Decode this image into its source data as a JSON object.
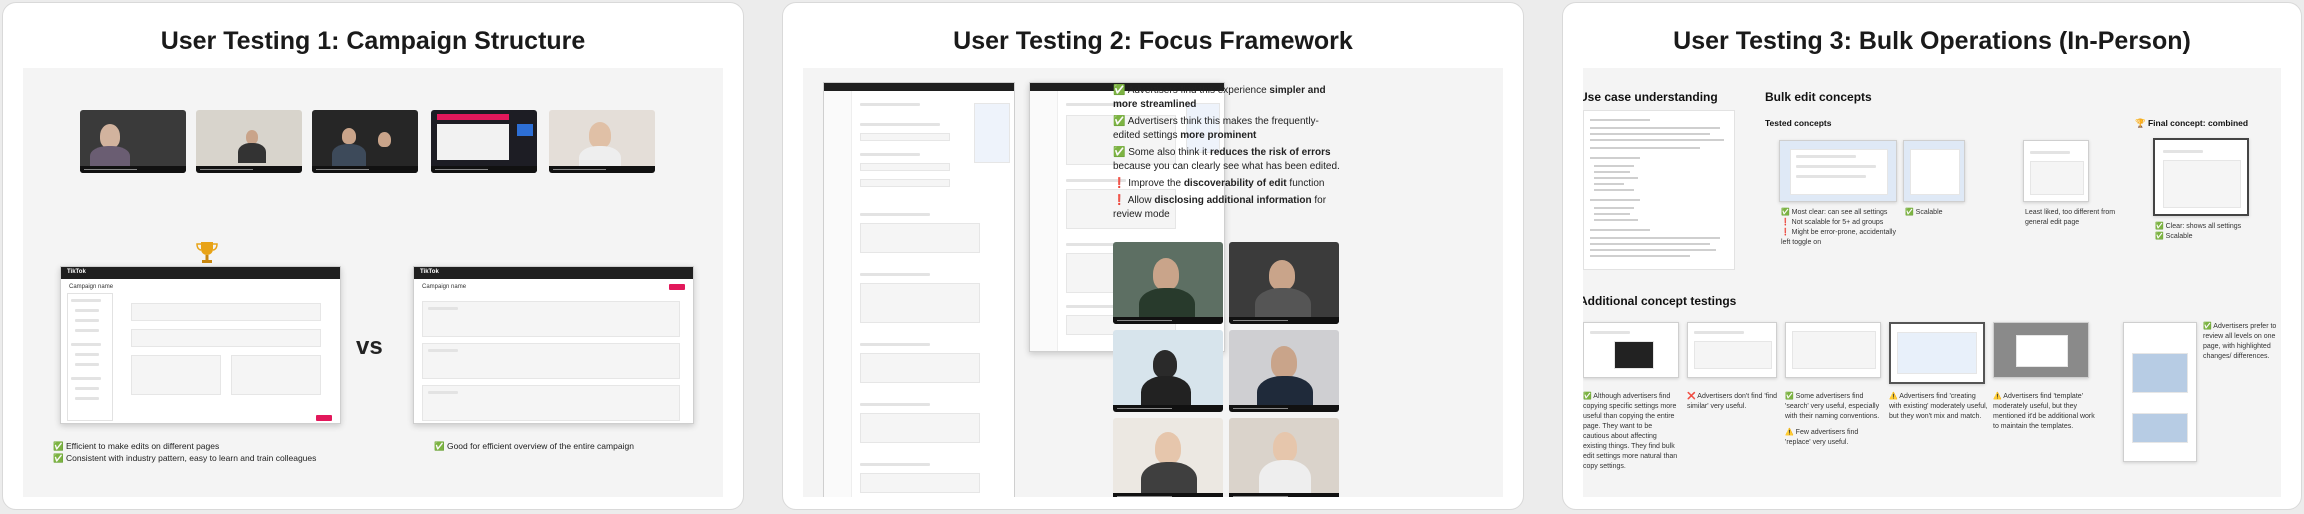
{
  "panels": {
    "p1": {
      "title": "User Testing 1: Campaign Structure",
      "vs": "vs",
      "left_mock": {
        "brand": "TikTok",
        "title": "Campaign name"
      },
      "right_mock": {
        "brand": "TikTok",
        "title": "Campaign name"
      },
      "left_notes": [
        "Efficient to make edits on different pages",
        "Consistent with industry pattern, easy to learn and train colleagues"
      ],
      "right_notes": [
        "Good for efficient overview of the entire campaign"
      ]
    },
    "p2": {
      "title": "User Testing 2: Focus Framework",
      "findings": [
        {
          "icon": "check",
          "pre": "Advertisers find this experience ",
          "bold": "simpler and more streamlined",
          "post": ""
        },
        {
          "icon": "check",
          "pre": "Advertisers think this makes the frequently-edited settings ",
          "bold": "more prominent",
          "post": ""
        },
        {
          "icon": "check",
          "pre": "Some also think it ",
          "bold": "reduces the risk of errors",
          "post": " because you can clearly see what has been edited."
        },
        {
          "icon": "exclaim",
          "pre": "Improve the ",
          "bold": "discoverability of edit",
          "post": " function"
        },
        {
          "icon": "exclaim",
          "pre": "Allow ",
          "bold": "disclosing additional information",
          "post": " for review mode"
        }
      ]
    },
    "p3": {
      "title": "User Testing 3: Bulk Operations (In-Person)",
      "use_case_heading": "Use case understanding",
      "bulk_heading": "Bulk edit concepts",
      "tested_label": "Tested concepts",
      "final_label": "Final concept: combined",
      "concept_notes": [
        {
          "icon": "check",
          "text": "Most clear: can see all settings"
        },
        {
          "icon": "exclaim",
          "text": "Not scalable for 5+ ad groups"
        },
        {
          "icon": "exclaim",
          "text": "Might be error-prone, accidentally left toggle on"
        }
      ],
      "scalable_note": "Scalable",
      "least_liked": "Least liked, too different from general edit page",
      "final_notes": [
        {
          "icon": "check",
          "text": "Clear: shows all settings"
        },
        {
          "icon": "check",
          "text": "Scalable"
        }
      ],
      "additional_heading": "Additional concept testings",
      "additional_notes": [
        "Although advertisers find copying specific settings more useful than copying the entire page. They want to be cautious about affecting existing things. They find bulk edit settings more natural than copy settings.",
        "Advertisers don't find 'find similar' very useful.",
        "Some advertisers find 'search' very useful, especially with their naming conventions.",
        "Few advertisers find 'replace' very useful.",
        "Advertisers find 'creating with existing' moderately useful, but they won't mix and match.",
        "Advertisers find 'template' moderately useful, but they mentioned it'd be additional work to maintain the templates.",
        "Advertisers prefer to review all levels on one page, with highlighted changes/ differences."
      ]
    }
  },
  "colors": {
    "accent": "#e2185b",
    "check": "#2e9e3e",
    "exclaim": "#d33333",
    "warn": "#e8a317"
  }
}
